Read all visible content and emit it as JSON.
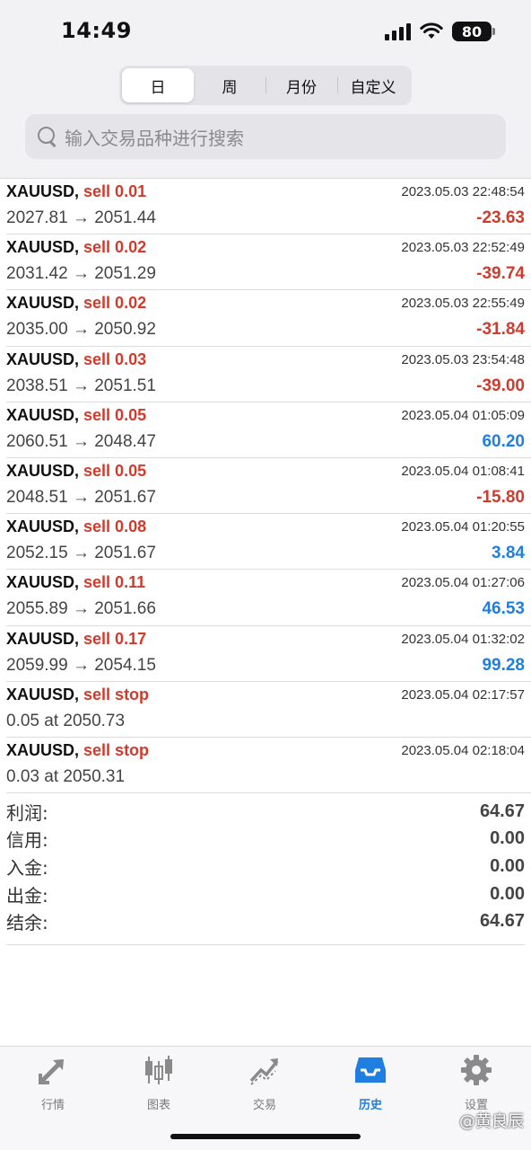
{
  "status_bar": {
    "time": "14:49",
    "battery": "80"
  },
  "segments": [
    {
      "label": "日",
      "active": true
    },
    {
      "label": "周",
      "active": false
    },
    {
      "label": "月份",
      "active": false
    },
    {
      "label": "自定义",
      "active": false
    }
  ],
  "search": {
    "placeholder": "输入交易品种进行搜索"
  },
  "rows": [
    {
      "symbol": "XAUUSD,",
      "action": "sell 0.01",
      "time": "2023.05.03 22:48:54",
      "detail": "2027.81 → 2051.44",
      "profit": "-23.63"
    },
    {
      "symbol": "XAUUSD,",
      "action": "sell 0.02",
      "time": "2023.05.03 22:52:49",
      "detail": "2031.42 → 2051.29",
      "profit": "-39.74"
    },
    {
      "symbol": "XAUUSD,",
      "action": "sell 0.02",
      "time": "2023.05.03 22:55:49",
      "detail": "2035.00 → 2050.92",
      "profit": "-31.84"
    },
    {
      "symbol": "XAUUSD,",
      "action": "sell 0.03",
      "time": "2023.05.03 23:54:48",
      "detail": "2038.51 → 2051.51",
      "profit": "-39.00"
    },
    {
      "symbol": "XAUUSD,",
      "action": "sell 0.05",
      "time": "2023.05.04 01:05:09",
      "detail": "2060.51 → 2048.47",
      "profit": "60.20"
    },
    {
      "symbol": "XAUUSD,",
      "action": "sell 0.05",
      "time": "2023.05.04 01:08:41",
      "detail": "2048.51 → 2051.67",
      "profit": "-15.80"
    },
    {
      "symbol": "XAUUSD,",
      "action": "sell 0.08",
      "time": "2023.05.04 01:20:55",
      "detail": "2052.15 → 2051.67",
      "profit": "3.84"
    },
    {
      "symbol": "XAUUSD,",
      "action": "sell 0.11",
      "time": "2023.05.04 01:27:06",
      "detail": "2055.89 → 2051.66",
      "profit": "46.53"
    },
    {
      "symbol": "XAUUSD,",
      "action": "sell 0.17",
      "time": "2023.05.04 01:32:02",
      "detail": "2059.99 → 2054.15",
      "profit": "99.28"
    },
    {
      "symbol": "XAUUSD,",
      "action": "sell stop",
      "time": "2023.05.04 02:17:57",
      "detail": "0.05 at 2050.73",
      "profit": ""
    },
    {
      "symbol": "XAUUSD,",
      "action": "sell stop",
      "time": "2023.05.04 02:18:04",
      "detail": "0.03 at 2050.31",
      "profit": ""
    }
  ],
  "summary": [
    {
      "label": "利润:",
      "value": "64.67"
    },
    {
      "label": "信用:",
      "value": "0.00"
    },
    {
      "label": "入金:",
      "value": "0.00"
    },
    {
      "label": "出金:",
      "value": "0.00"
    },
    {
      "label": "结余:",
      "value": "64.67"
    }
  ],
  "tabs": [
    {
      "label": "行情",
      "icon": "quotes-arrows-icon",
      "active": false
    },
    {
      "label": "图表",
      "icon": "candlestick-chart-icon",
      "active": false
    },
    {
      "label": "交易",
      "icon": "trade-chart-icon",
      "active": false
    },
    {
      "label": "历史",
      "icon": "history-inbox-icon",
      "active": true
    },
    {
      "label": "设置",
      "icon": "gear-icon",
      "active": false
    }
  ],
  "watermark": "@黄良辰",
  "colors": {
    "sell": "#d23a2c",
    "negative": "#d23a2c",
    "positive": "#1f7fe0",
    "active_tab": "#1f7fe0",
    "inactive_tab": "#7a7a7a"
  }
}
